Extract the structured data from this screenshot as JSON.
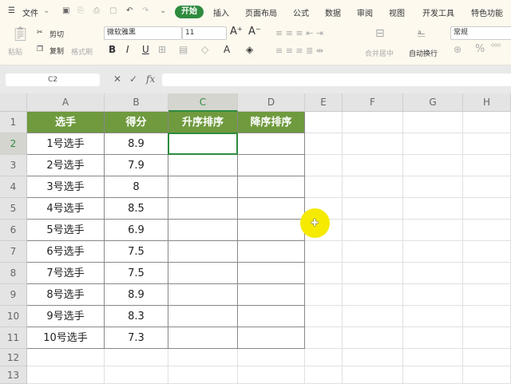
{
  "menu": {
    "file": "文件",
    "tabs": [
      "开始",
      "插入",
      "页面布局",
      "公式",
      "数据",
      "审阅",
      "视图",
      "开发工具",
      "特色功能"
    ]
  },
  "ribbon": {
    "paste": "粘贴",
    "cut": "剪切",
    "copy": "复制",
    "format_painter": "格式刷",
    "font": "微软雅黑",
    "size": "11",
    "bold": "B",
    "italic": "I",
    "underline": "U",
    "merge": "合并居中",
    "wrap": "自动换行",
    "number_format": "常规",
    "percent": "%"
  },
  "formula_bar": {
    "name_box": "C2",
    "cancel": "✕",
    "confirm": "✓",
    "fx": "fx",
    "value": ""
  },
  "columns": [
    "A",
    "B",
    "C",
    "D",
    "E",
    "F",
    "G",
    "H"
  ],
  "rows": [
    "1",
    "2",
    "3",
    "4",
    "5",
    "6",
    "7",
    "8",
    "9",
    "10",
    "11",
    "12",
    "13"
  ],
  "table": {
    "headers": [
      "选手",
      "得分",
      "升序排序",
      "降序排序"
    ],
    "data": [
      [
        "1号选手",
        "8.9"
      ],
      [
        "2号选手",
        "7.9"
      ],
      [
        "3号选手",
        "8"
      ],
      [
        "4号选手",
        "8.5"
      ],
      [
        "5号选手",
        "6.9"
      ],
      [
        "6号选手",
        "7.5"
      ],
      [
        "7号选手",
        "7.5"
      ],
      [
        "8号选手",
        "8.9"
      ],
      [
        "9号选手",
        "8.3"
      ],
      [
        "10号选手",
        "7.3"
      ]
    ]
  },
  "colors": {
    "accent": "#2e8b3e",
    "header_fill": "#6f9a3e",
    "cursor": "#f5ea00"
  }
}
